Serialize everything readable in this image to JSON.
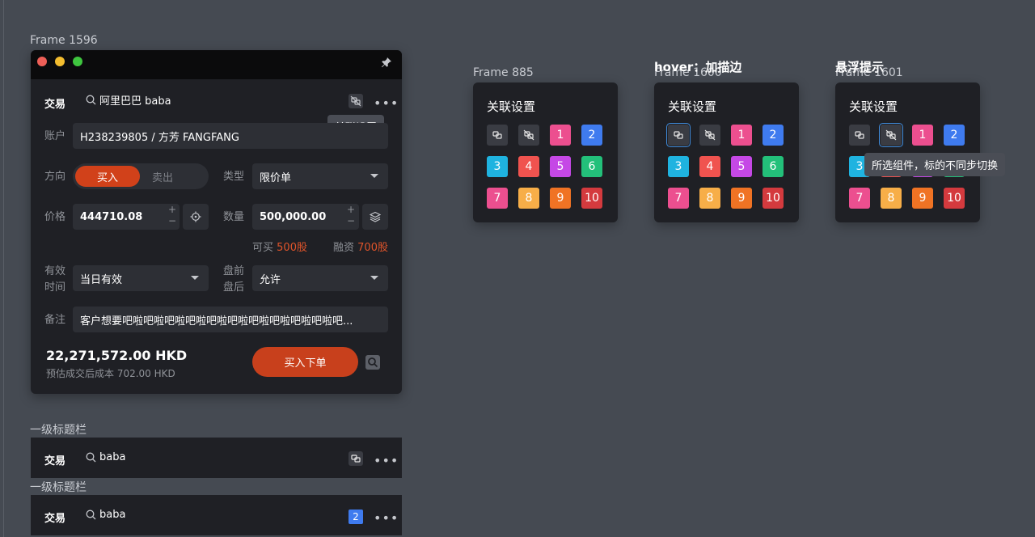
{
  "canvas": {
    "frame_main": "Frame 1596",
    "frame_885": "Frame 885",
    "frame_1600": "Frame 1600",
    "frame_1601": "Frame 1601",
    "hover_note": "hover：加描边",
    "tooltip_note": "悬浮提示",
    "bar1_label": "一级标题栏",
    "bar2_label": "一级标题栏"
  },
  "window": {
    "title": "交易",
    "search_value": "阿里巴巴 baba",
    "link_tooltip": "关联设置",
    "account_label": "账户",
    "account_value": "H238239805 / 方芳 FANGFANG",
    "direction_label": "方向",
    "buy_label": "买入",
    "sell_label": "卖出",
    "type_label": "类型",
    "type_value": "限价单",
    "price_label": "价格",
    "price_value": "444710.08",
    "qty_label": "数量",
    "qty_value": "500,000.00",
    "plus": "+",
    "minus": "−",
    "can_buy_label": "可买",
    "can_buy_value": "500股",
    "margin_label": "融资",
    "margin_value": "700股",
    "validity_label_1": "有效",
    "validity_label_2": "时间",
    "validity_value": "当日有效",
    "prepost_label_1": "盘前",
    "prepost_label_2": "盘后",
    "prepost_value": "允许",
    "note_label": "备注",
    "note_value": "客户想要吧啦吧啦吧啦吧啦吧啦吧啦吧啦吧啦吧啦吧啦吧...",
    "total": "22,271,572.00 HKD",
    "est_cost": "预估成交后成本 702.00 HKD",
    "order_button": "买入下单",
    "more": "•••"
  },
  "bar1": {
    "title": "交易",
    "search_value": "baba",
    "more": "•••"
  },
  "bar2": {
    "title": "交易",
    "search_value": "baba",
    "badge": "2",
    "more": "•••"
  },
  "panels": [
    {
      "title": "关联设置",
      "tiles": [
        "",
        "",
        "1",
        "2",
        "3",
        "4",
        "5",
        "6",
        "7",
        "8",
        "9",
        "10"
      ]
    },
    {
      "title": "关联设置",
      "tiles": [
        "",
        "",
        "1",
        "2",
        "3",
        "4",
        "5",
        "6",
        "7",
        "8",
        "9",
        "10"
      ]
    },
    {
      "title": "关联设置",
      "tiles": [
        "",
        "",
        "1",
        "2",
        "3",
        "4",
        "5",
        "6",
        "7",
        "8",
        "9",
        "10"
      ],
      "tooltip": "所选组件，标的不同步切换"
    }
  ],
  "colors": {
    "t1": "#ec4f8f",
    "t2": "#3f7bef",
    "t3": "#1fb3e0",
    "t4": "#f0534f",
    "t5": "#c548e6",
    "t6": "#23c07a",
    "t7": "#ec4f8f",
    "t8": "#f7ae48",
    "t9": "#f07324",
    "t10": "#d43a3e",
    "accent": "#d1411a"
  },
  "icons": [
    "link-icon",
    "unlink-icon",
    "pin-icon",
    "search-icon",
    "target-icon",
    "layers-icon",
    "search-square-icon"
  ]
}
